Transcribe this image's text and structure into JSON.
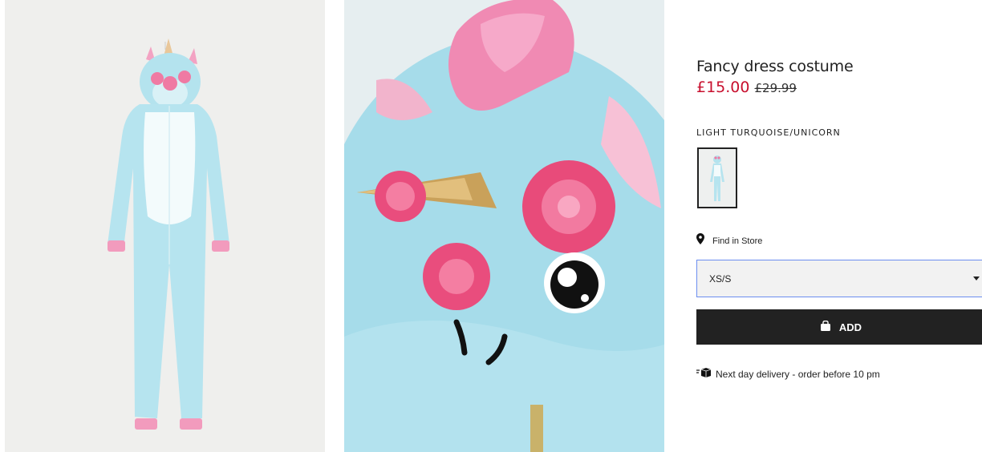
{
  "product": {
    "title": "Fancy dress costume",
    "price_current": "£15.00",
    "price_original": "£29.99",
    "color_label": "LIGHT TURQUOISE/UNICORN"
  },
  "images": [
    {
      "alt": "unicorn-onesie-front-image"
    },
    {
      "alt": "unicorn-hood-detail-image"
    }
  ],
  "find_in_store": {
    "label": "Find in Store",
    "icon": "location-pin-icon"
  },
  "size_select": {
    "selected": "XS/S",
    "icon": "chevron-down-icon"
  },
  "add_button": {
    "label": "ADD",
    "icon": "shopping-bag-icon"
  },
  "delivery": {
    "text": "Next day delivery - order before 10 pm",
    "icon": "delivery-truck-icon"
  },
  "colors": {
    "sale": "#c8102e",
    "button_bg": "#222222",
    "select_border": "#6c8ef0",
    "select_bg": "#f2f2f2"
  }
}
